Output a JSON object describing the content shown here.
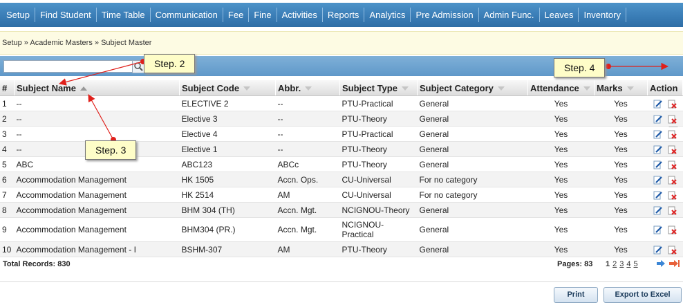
{
  "nav": [
    "Setup",
    "Find Student",
    "Time Table",
    "Communication",
    "Fee",
    "Fine",
    "Activities",
    "Reports",
    "Analytics",
    "Pre Admission",
    "Admin Func.",
    "Leaves",
    "Inventory"
  ],
  "breadcrumb": "Setup » Academic Masters » Subject Master",
  "search": {
    "value": ""
  },
  "columns": {
    "num": "#",
    "name": "Subject Name",
    "code": "Subject Code",
    "abbr": "Abbr.",
    "type": "Subject Type",
    "category": "Subject Category",
    "attendance": "Attendance",
    "marks": "Marks",
    "action": "Action"
  },
  "rows": [
    {
      "num": "1",
      "name": "--",
      "code": "ELECTIVE 2",
      "abbr": "--",
      "type": "PTU-Practical",
      "category": "General",
      "attendance": "Yes",
      "marks": "Yes"
    },
    {
      "num": "2",
      "name": "--",
      "code": "Elective 3",
      "abbr": "--",
      "type": "PTU-Theory",
      "category": "General",
      "attendance": "Yes",
      "marks": "Yes"
    },
    {
      "num": "3",
      "name": "--",
      "code": "Elective 4",
      "abbr": "--",
      "type": "PTU-Practical",
      "category": "General",
      "attendance": "Yes",
      "marks": "Yes"
    },
    {
      "num": "4",
      "name": "--",
      "code": "Elective 1",
      "abbr": "--",
      "type": "PTU-Theory",
      "category": "General",
      "attendance": "Yes",
      "marks": "Yes"
    },
    {
      "num": "5",
      "name": "ABC",
      "code": "ABC123",
      "abbr": "ABCc",
      "type": "PTU-Theory",
      "category": "General",
      "attendance": "Yes",
      "marks": "Yes"
    },
    {
      "num": "6",
      "name": "Accommodation Management",
      "code": "HK 1505",
      "abbr": "Accn. Ops.",
      "type": "CU-Universal",
      "category": "For no category",
      "attendance": "Yes",
      "marks": "Yes"
    },
    {
      "num": "7",
      "name": "Accommodation Management",
      "code": "HK 2514",
      "abbr": "AM",
      "type": "CU-Universal",
      "category": "For no category",
      "attendance": "Yes",
      "marks": "Yes"
    },
    {
      "num": "8",
      "name": "Accommodation Management",
      "code": "BHM 304 (TH)",
      "abbr": "Accn. Mgt.",
      "type": "NCIGNOU-Theory",
      "category": "General",
      "attendance": "Yes",
      "marks": "Yes"
    },
    {
      "num": "9",
      "name": "Accommodation Management",
      "code": "BHM304 (PR.)",
      "abbr": "Accn. Mgt.",
      "type": "NCIGNOU-Practical",
      "category": "General",
      "attendance": "Yes",
      "marks": "Yes"
    },
    {
      "num": "10",
      "name": "Accommodation Management - I",
      "code": "BSHM-307",
      "abbr": "AM",
      "type": "PTU-Theory",
      "category": "General",
      "attendance": "Yes",
      "marks": "Yes"
    }
  ],
  "footer": {
    "total_label": "Total Records:",
    "total": "830",
    "pages_label": "Pages:",
    "pages": "83",
    "page_links": [
      "1",
      "2",
      "3",
      "4",
      "5"
    ]
  },
  "buttons": {
    "print": "Print",
    "export": "Export to Excel"
  },
  "callouts": {
    "step2": "Step. 2",
    "step3": "Step. 3",
    "step4": "Step. 4"
  },
  "colors": {
    "nav": "#3a7db6",
    "callout": "#fefdc8",
    "arrow": "#e0201b"
  },
  "icons": {
    "search": "search-icon",
    "add": "add-record-icon",
    "edit": "edit-icon",
    "delete": "delete-icon",
    "next": "next-page-icon",
    "last": "last-page-icon"
  }
}
